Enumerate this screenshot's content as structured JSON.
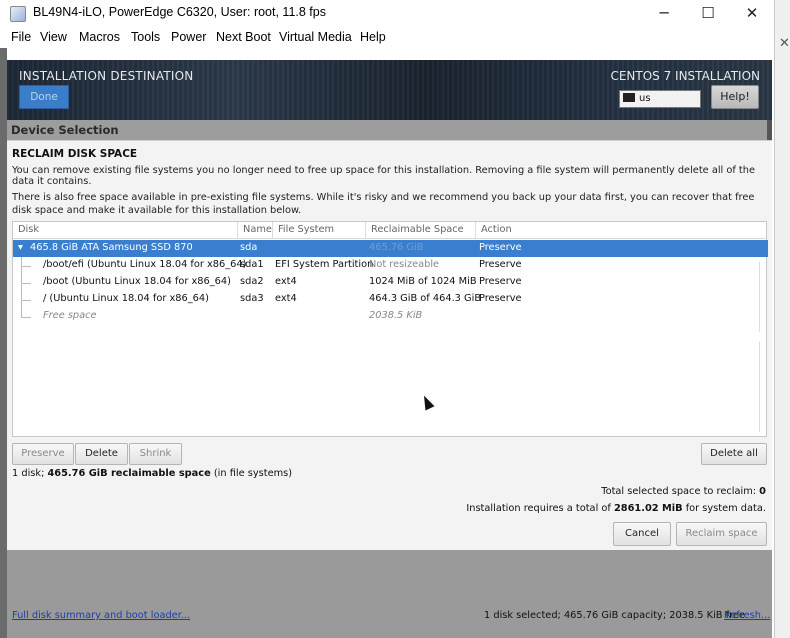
{
  "window": {
    "title": "BL49N4-iLO, PowerEdge C6320, User: root, 11.8 fps",
    "minimize": "─",
    "maximize": "☐",
    "close": "✕",
    "side_close": "✕"
  },
  "menubar": [
    "File",
    "View",
    "Macros",
    "Tools",
    "Power",
    "Next Boot",
    "Virtual Media",
    "Help"
  ],
  "installer": {
    "header_title": "INSTALLATION DESTINATION",
    "header_right": "CENTOS 7 INSTALLATION",
    "done_label": "Done",
    "keyboard_layout": "us",
    "help_label": "Help!",
    "device_selection": "Device Selection"
  },
  "reclaim": {
    "title": "RECLAIM DISK SPACE",
    "paragraph1": "You can remove existing file systems you no longer need to free up space for this installation.  Removing a file system will permanently delete all of the data it contains.",
    "paragraph2": "There is also free space available in pre-existing file systems.  While it's risky and we recommend you back up your data first, you can recover that free disk space and make it available for this installation below.",
    "columns": [
      "Disk",
      "Name",
      "File System",
      "Reclaimable Space",
      "Action"
    ],
    "rows": [
      {
        "disk": "465.8 GiB ATA Samsung SSD 870",
        "name": "sda",
        "fs": "",
        "space": "465.76 GiB",
        "action": "Preserve"
      },
      {
        "disk": "/boot/efi (Ubuntu Linux 18.04 for x86_64)",
        "name": "sda1",
        "fs": "EFI System Partition",
        "space": "Not resizeable",
        "action": "Preserve"
      },
      {
        "disk": "/boot (Ubuntu Linux 18.04 for x86_64)",
        "name": "sda2",
        "fs": "ext4",
        "space": "1024 MiB of 1024 MiB",
        "action": "Preserve"
      },
      {
        "disk": "/ (Ubuntu Linux 18.04 for x86_64)",
        "name": "sda3",
        "fs": "ext4",
        "space": "464.3 GiB of 464.3 GiB",
        "action": "Preserve"
      },
      {
        "disk": "Free space",
        "name": "",
        "fs": "",
        "space": "2038.5 KiB",
        "action": ""
      }
    ],
    "buttons": {
      "preserve": "Preserve",
      "delete": "Delete",
      "shrink": "Shrink",
      "delete_all": "Delete all"
    },
    "summary_prefix": "1 disk; ",
    "summary_bold": "465.76 GiB reclaimable space",
    "summary_suffix": " (in file systems)",
    "total_selected_label": "Total selected space to reclaim: ",
    "total_selected_value": "0",
    "requires_prefix": "Installation requires a total of ",
    "requires_value": "2861.02 MiB",
    "requires_suffix": " for system data.",
    "cancel_label": "Cancel",
    "reclaim_label": "Reclaim space"
  },
  "statusbar": {
    "full_disk_link": "Full disk summary and boot loader...",
    "status": "1 disk selected; 465.76 GiB capacity; 2038.5 KiB free",
    "refresh_link": "Refresh..."
  }
}
